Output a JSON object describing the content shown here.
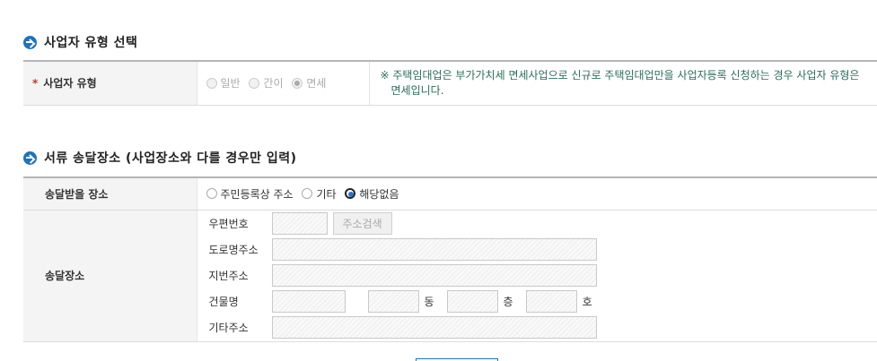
{
  "section1": {
    "title": "사업자 유형 선택",
    "row_label": "사업자 유형",
    "required_mark": "*",
    "options": [
      {
        "label": "일반",
        "selected": false
      },
      {
        "label": "간이",
        "selected": false
      },
      {
        "label": "면세",
        "selected": true
      }
    ],
    "note": "※ 주택임대업은 부가가치세 면세사업으로 신규로 주택임대업만을 사업자등록 신청하는 경우 사업자 유형은 면세입니다."
  },
  "section2": {
    "title": "서류 송달장소 (사업장소와 다를 경우만 입력)",
    "place_label": "송달받을 장소",
    "place_options": [
      {
        "label": "주민등록상 주소",
        "selected": false
      },
      {
        "label": "기타",
        "selected": false
      },
      {
        "label": "해당없음",
        "selected": true
      }
    ],
    "address_label": "송달장소",
    "postcode_label": "우편번호",
    "search_button": "주소검색",
    "road_label": "도로명주소",
    "lot_label": "지번주소",
    "building_label": "건물명",
    "dong_unit": "동",
    "floor_unit": "층",
    "ho_unit": "호",
    "etc_label": "기타주소"
  },
  "colors": {
    "accent": "#1e73be",
    "note": "#2a6e5c",
    "required": "#c0392b"
  }
}
